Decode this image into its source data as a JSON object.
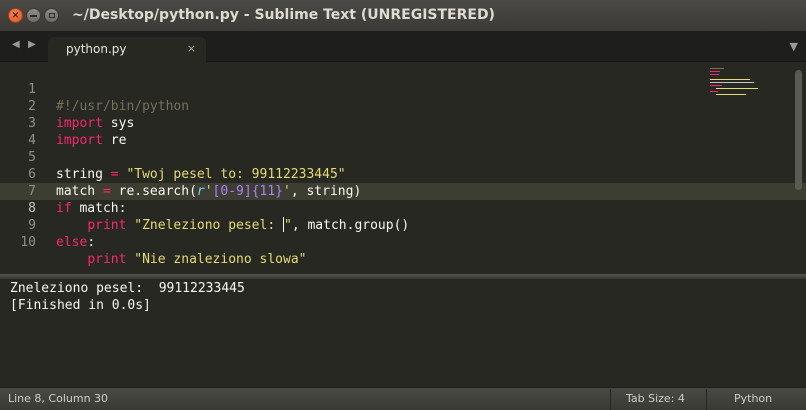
{
  "window": {
    "title": "~/Desktop/python.py - Sublime Text (UNREGISTERED)",
    "controls": {
      "close_icon": "close-icon",
      "minimize_icon": "minimize-icon",
      "maximize_icon": "maximize-icon"
    }
  },
  "tabs": {
    "nav_left": "◀",
    "nav_right": "▶",
    "items": [
      {
        "label": "python.py",
        "active": true,
        "close": "×"
      }
    ],
    "dropdown": "▼"
  },
  "editor": {
    "current_line": 8,
    "line_numbers": [
      "1",
      "2",
      "3",
      "4",
      "5",
      "6",
      "7",
      "8",
      "9",
      "10"
    ],
    "code": {
      "l1": {
        "comment": "#!/usr/bin/python"
      },
      "l2": {
        "kw": "import",
        "rest": " sys"
      },
      "l3": {
        "kw": "import",
        "rest": " re"
      },
      "l5": {
        "var": "string ",
        "op": "=",
        "str": " \"Twoj pesel to: 99112233445\""
      },
      "l6": {
        "var": "match ",
        "op": "=",
        "call": " re.search(",
        "rprefix": "r",
        "q1": "'",
        "cls": "[0-9]",
        "quant": "{11}",
        "q2": "'",
        "rest": ", string)"
      },
      "l7": {
        "kw": "if",
        "rest": " match:"
      },
      "l8": {
        "indent": "    ",
        "kw": "print",
        "str_a": " \"Zneleziono pesel: ",
        "str_b": "\"",
        "rest": ", match.group()"
      },
      "l9": {
        "kw": "else",
        "rest": ":"
      },
      "l10": {
        "indent": "    ",
        "kw": "print",
        "str": " \"Nie znaleziono slowa\""
      }
    }
  },
  "output": {
    "lines": [
      "Zneleziono pesel:  99112233445",
      "[Finished in 0.0s]"
    ]
  },
  "status": {
    "position": "Line 8, Column 30",
    "tab_size": "Tab Size: 4",
    "syntax": "Python"
  },
  "colors": {
    "background": "#272822",
    "keyword": "#f92672",
    "string": "#e6db74",
    "comment": "#75715e",
    "constant": "#ae81ff",
    "support": "#66d9ef"
  }
}
